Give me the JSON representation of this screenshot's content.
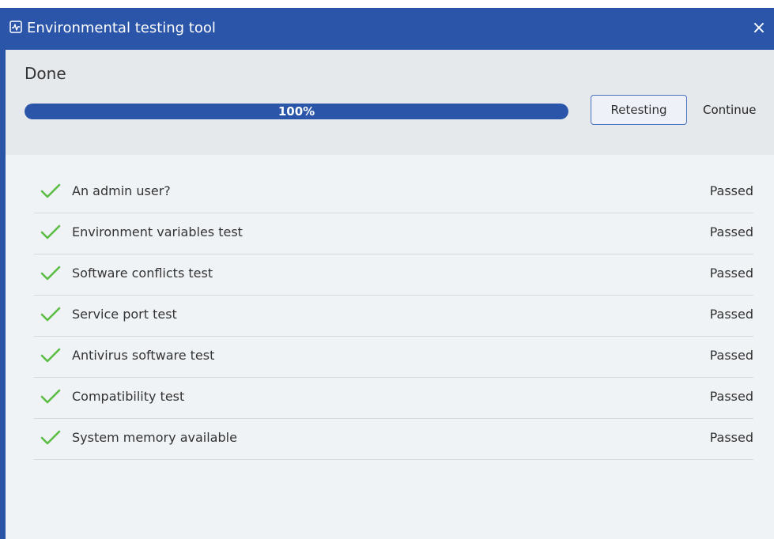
{
  "window": {
    "title": "Environmental testing tool",
    "close_label": "×",
    "title_icon": "heartbeat-monitor-icon"
  },
  "header": {
    "status": "Done",
    "progress": {
      "value": 100,
      "label": "100%"
    },
    "retest_label": "Retesting",
    "continue_label": "Continue"
  },
  "colors": {
    "titlebar": "#2a55a8",
    "progress_fill": "#2a55a8",
    "check": "#5bbd45"
  },
  "tests": [
    {
      "label": "An admin user?",
      "status": "Passed",
      "icon": "check-icon"
    },
    {
      "label": "Environment variables test",
      "status": "Passed",
      "icon": "check-icon"
    },
    {
      "label": "Software conflicts test",
      "status": "Passed",
      "icon": "check-icon"
    },
    {
      "label": "Service port test",
      "status": "Passed",
      "icon": "check-icon"
    },
    {
      "label": "Antivirus software test",
      "status": "Passed",
      "icon": "check-icon"
    },
    {
      "label": "Compatibility test",
      "status": "Passed",
      "icon": "check-icon"
    },
    {
      "label": "System memory available",
      "status": "Passed",
      "icon": "check-icon"
    }
  ]
}
